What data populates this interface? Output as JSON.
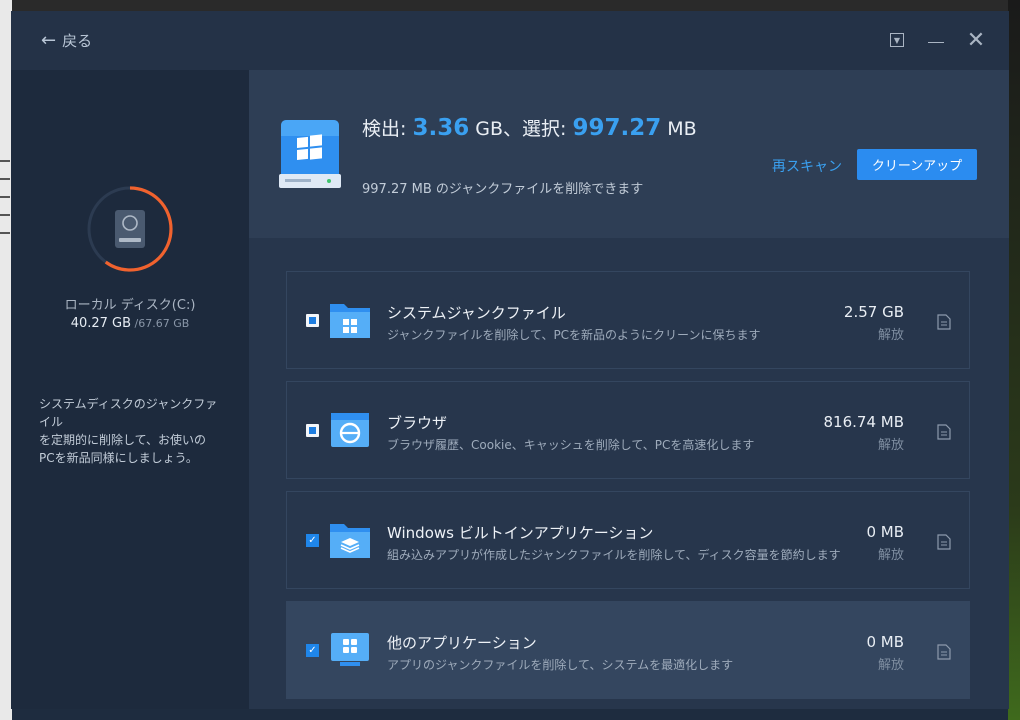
{
  "colors": {
    "accent": "#3aa0f0",
    "button": "#2b8cf0",
    "ring": "#f0622e",
    "window_bg": "#243247"
  },
  "titlebar": {
    "back_label": "戻る"
  },
  "sidebar": {
    "disk_label": "ローカル ディスク(C:)",
    "disk_used": "40.27 GB",
    "disk_total": " /67.67 GB",
    "ring_fraction": 0.6,
    "description": "システムディスクのジャンクファイル\nを定期的に削除して、お使いの\nPCを新品同様にしましょう。"
  },
  "summary": {
    "found_label": "検出: ",
    "found_value": "3.36",
    "found_unit": " GB、選択: ",
    "selected_value": "997.27",
    "selected_unit": " MB",
    "subtitle": "997.27 MB のジャンクファイルを削除できます",
    "rescan_label": "再スキャン",
    "cleanup_label": "クリーンアップ"
  },
  "categories": [
    {
      "title": "システムジャンクファイル",
      "desc": "ジャンクファイルを削除して、PCを新品のようにクリーンに保ちます",
      "size": "2.57 GB",
      "action": "解放",
      "check": "partial",
      "icon": "windows-folder-icon"
    },
    {
      "title": "ブラウザ",
      "desc": "ブラウザ履歴、Cookie、キャッシュを削除して、PCを高速化します",
      "size": "816.74 MB",
      "action": "解放",
      "check": "partial",
      "icon": "browser-icon"
    },
    {
      "title": "Windows ビルトインアプリケーション",
      "desc": "組み込みアプリが作成したジャンクファイルを削除して、ディスク容量を節約します",
      "size": "0 MB",
      "action": "解放",
      "check": "checked",
      "icon": "layers-folder-icon"
    },
    {
      "title": "他のアプリケーション",
      "desc": "アプリのジャンクファイルを削除して、システムを最適化します",
      "size": "0 MB",
      "action": "解放",
      "check": "checked",
      "icon": "apps-monitor-icon"
    }
  ]
}
